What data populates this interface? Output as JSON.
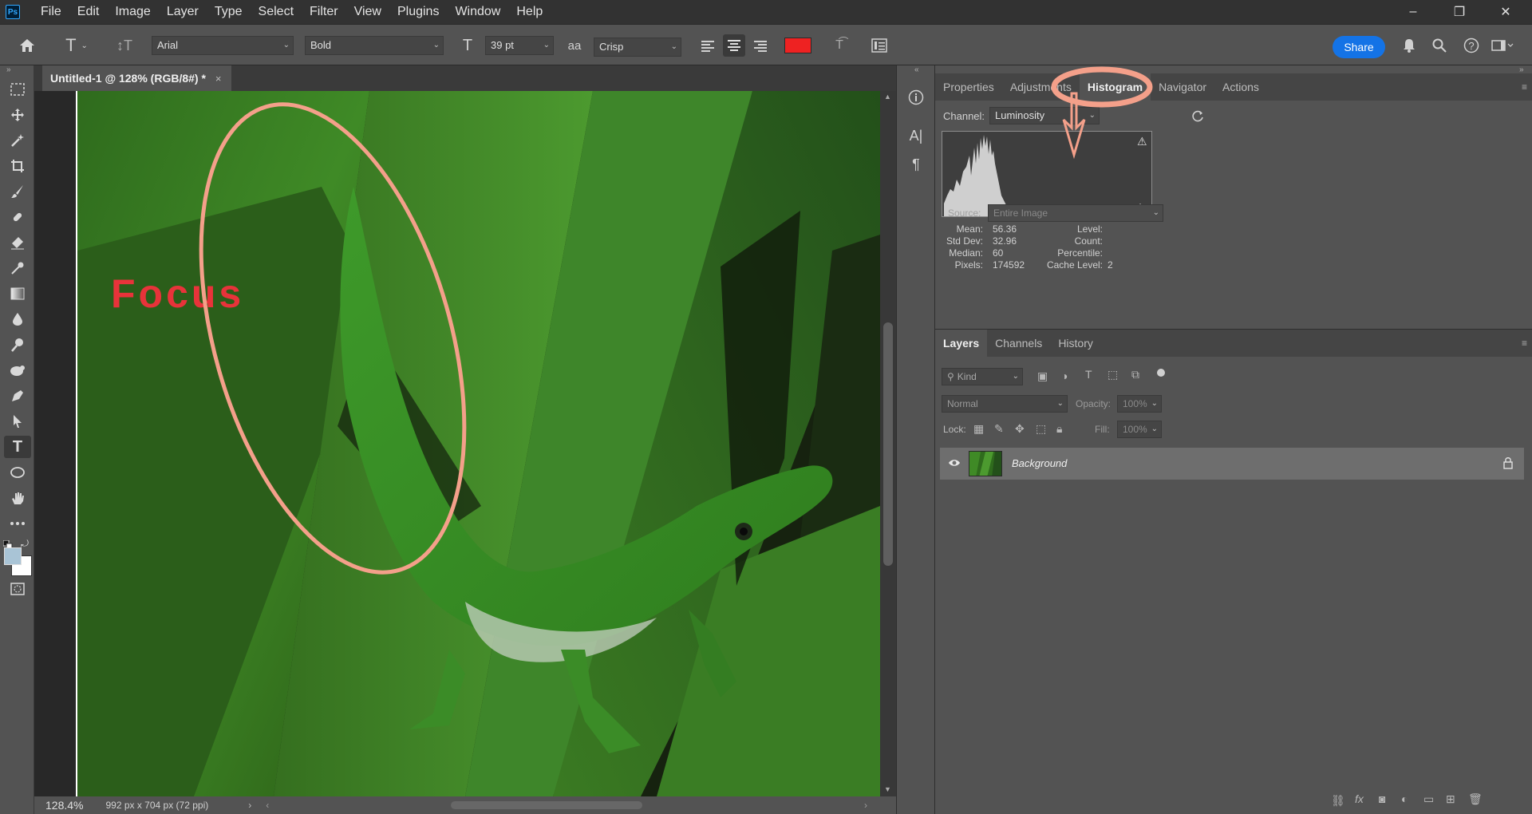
{
  "menubar": {
    "logo": "Ps",
    "items": [
      "File",
      "Edit",
      "Image",
      "Layer",
      "Type",
      "Select",
      "Filter",
      "View",
      "Plugins",
      "Window",
      "Help"
    ],
    "window_controls": [
      "–",
      "❐",
      "✕"
    ]
  },
  "options": {
    "font_family": "Arial",
    "font_style": "Bold",
    "font_size": "39 pt",
    "antialias_label": "aa",
    "antialias": "Crisp",
    "text_color": "#ee2222",
    "share_label": "Share"
  },
  "document": {
    "tab_title": "Untitled-1 @ 128% (RGB/8#) *",
    "close": "×",
    "overlay_text": "Focus",
    "overlay_color": "#e8333a",
    "annotation_color": "#f4a08a"
  },
  "status": {
    "zoom": "128.4%",
    "info": "992 px x 704 px (72 ppi)"
  },
  "histogram_panel": {
    "tabs": [
      "Properties",
      "Adjustments",
      "Histogram",
      "Navigator",
      "Actions"
    ],
    "active_tab": "Histogram",
    "channel_label": "Channel:",
    "channel_value": "Luminosity",
    "source_label": "Source:",
    "source_value": "Entire Image",
    "stats": {
      "mean_label": "Mean:",
      "mean": "56.36",
      "stddev_label": "Std Dev:",
      "stddev": "32.96",
      "median_label": "Median:",
      "median": "60",
      "pixels_label": "Pixels:",
      "pixels": "174592",
      "level_label": "Level:",
      "level": "",
      "count_label": "Count:",
      "count": "",
      "percentile_label": "Percentile:",
      "percentile": "",
      "cache_label": "Cache Level:",
      "cache": "2"
    }
  },
  "layers_panel": {
    "tabs": [
      "Layers",
      "Channels",
      "History"
    ],
    "active_tab": "Layers",
    "filter_kind": "Kind",
    "blend_mode": "Normal",
    "opacity_label": "Opacity:",
    "opacity": "100%",
    "lock_label": "Lock:",
    "fill_label": "Fill:",
    "fill": "100%",
    "layers": [
      {
        "name": "Background",
        "visible": true,
        "locked": true
      }
    ]
  }
}
